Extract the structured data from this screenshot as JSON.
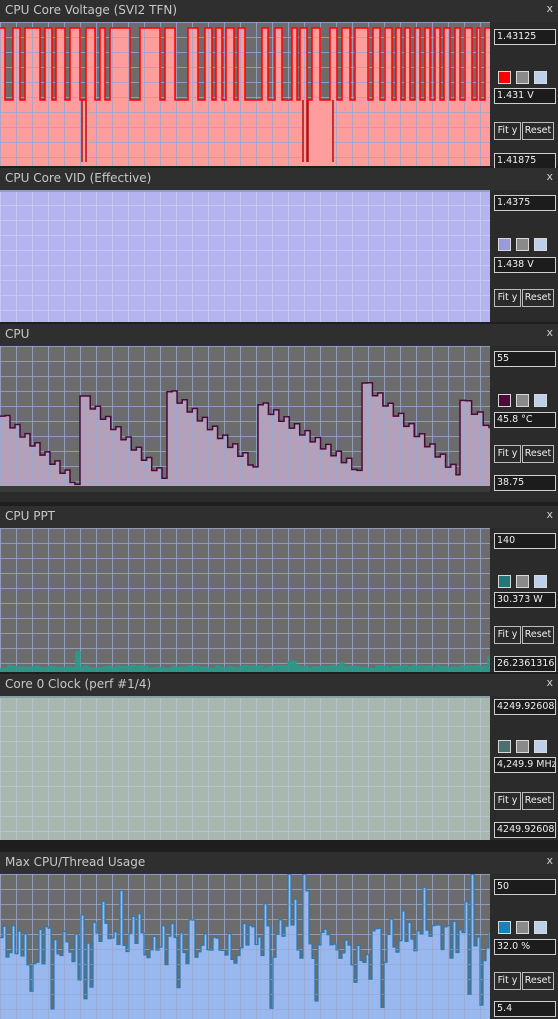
{
  "panels": [
    {
      "title": "CPU Core Voltage (SVI2 TFN)",
      "close_label": "x",
      "max_label": "1.43125",
      "current_label": "1.431 V",
      "min_label": "1.41875",
      "fit_label": "Fit y",
      "reset_label": "Reset",
      "colors": {
        "line": "#ff0000",
        "fill": "#ff9c9c",
        "plot_bg": "#6c6c6c",
        "grid": "#9aa8d0",
        "swatch": "#ff0000"
      },
      "series_kind": "square_wave",
      "transitions": [
        5,
        13,
        20,
        25,
        40,
        45,
        52,
        56,
        65,
        70,
        80,
        86,
        95,
        100,
        105,
        110,
        130,
        140,
        160,
        165,
        175,
        188,
        198,
        205,
        212,
        216,
        222,
        226,
        234,
        238,
        245,
        262,
        268,
        275,
        282,
        292,
        297,
        300,
        307,
        312,
        320,
        330,
        337,
        342,
        350,
        355,
        368,
        373,
        380,
        385,
        392,
        396,
        401,
        405,
        410,
        415,
        420,
        425,
        430,
        435,
        440,
        444,
        450,
        455,
        460,
        465,
        472,
        477,
        480,
        485
      ],
      "dips": [
        [
          82,
          86
        ],
        [
          303,
          307
        ],
        [
          308,
          333
        ]
      ],
      "high": 1.43125,
      "low": 1.425,
      "dip_low": 1.41875,
      "range": [
        1.41875,
        1.43125
      ]
    },
    {
      "title": "CPU Core VID (Effective)",
      "close_label": "x",
      "max_label": "1.4375",
      "current_label": "1.438 V",
      "min_label": "",
      "fit_label": "Fit y",
      "reset_label": "Reset",
      "colors": {
        "line": "#8aa0c8",
        "fill": "#b4b4f0",
        "plot_bg": "#b4b4f0",
        "grid": "#c6d0f4",
        "swatch": "#9a9ad8"
      },
      "series_kind": "flat",
      "value": 1.4375,
      "range": [
        1.43,
        1.4375
      ]
    },
    {
      "title": "CPU",
      "close_label": "x",
      "max_label": "55",
      "current_label": "45.8 °C",
      "min_label": "38.75",
      "fit_label": "Fit y",
      "reset_label": "Reset",
      "colors": {
        "line": "#4a0a3a",
        "fill": "#b4a0b8",
        "plot_bg": "#6c6c6c",
        "grid": "#9aa8d0",
        "swatch": "#4a0a3a"
      },
      "series_kind": "sawtooth",
      "peaks": [
        [
          0,
          47.2
        ],
        [
          80,
          49.5
        ],
        [
          167,
          50.0
        ],
        [
          258,
          48.5
        ],
        [
          362,
          51.0
        ],
        [
          460,
          49.0
        ]
      ],
      "troughs": [
        [
          75,
          39.4
        ],
        [
          162,
          40.1
        ],
        [
          253,
          41.4
        ],
        [
          357,
          41.0
        ],
        [
          456,
          40.5
        ],
        [
          489,
          45.8
        ]
      ],
      "range": [
        38.75,
        55
      ]
    },
    {
      "title": "CPU PPT",
      "close_label": "x",
      "max_label": "140",
      "current_label": "30.373 W",
      "min_label": "26.2361316",
      "fit_label": "Fit y",
      "reset_label": "Reset",
      "colors": {
        "line": "#2a9a8a",
        "fill": "#2a9a8a",
        "plot_bg": "#6c6c6c",
        "grid": "#9aa8d0",
        "swatch": "#207878"
      },
      "series_kind": "noise",
      "baseline": 29.5,
      "spikes": [
        [
          75,
          42
        ],
        [
          290,
          34
        ],
        [
          340,
          33
        ],
        [
          489,
          38
        ]
      ],
      "range": [
        26.2361316,
        140
      ]
    },
    {
      "title": "Core 0 Clock (perf #1/4)",
      "close_label": "x",
      "max_label": "4249.92608",
      "current_label": "4,249.9 MHz",
      "min_label": "4249.92608",
      "fit_label": "Fit y",
      "reset_label": "Reset",
      "colors": {
        "line": "#8aa0a8",
        "fill": "#a8b8b0",
        "plot_bg": "#a8b8b0",
        "grid": "#b8c8d0",
        "swatch": "#4a7070"
      },
      "series_kind": "flat",
      "value": 4249.92608,
      "range": [
        4249.9,
        4249.93
      ]
    },
    {
      "title": "Max CPU/Thread Usage",
      "close_label": "x",
      "max_label": "50",
      "current_label": "32.0 %",
      "min_label": "5.4",
      "fit_label": "Fit y",
      "reset_label": "Reset",
      "colors": {
        "line": "#2a7ab0",
        "fill": "#9ab8f0",
        "plot_bg": "#6c6c6c",
        "grid": "#9aa8d0",
        "swatch": "#1a80c0"
      },
      "series_kind": "random_bars",
      "range": [
        5.4,
        50
      ]
    }
  ]
}
